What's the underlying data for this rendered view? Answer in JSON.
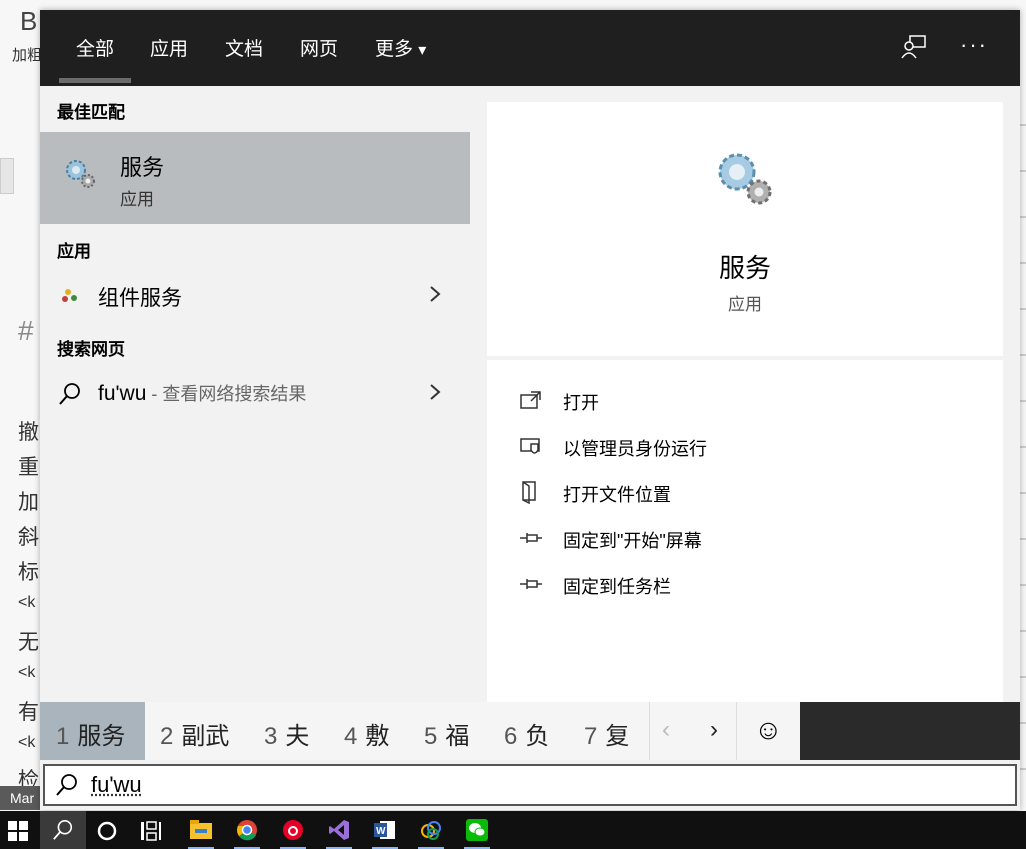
{
  "background": {
    "title_fragment": "B",
    "sub_fragment": "加粗",
    "hash": "#",
    "mar_label": "Mar",
    "left_chars": [
      "撤",
      "重",
      "加",
      "斜",
      "标",
      "<k",
      "无",
      "<k",
      "有",
      "<k",
      "检"
    ]
  },
  "nav": {
    "tabs": [
      "全部",
      "应用",
      "文档",
      "网页",
      "更多"
    ],
    "more_arrow": "▾",
    "more_dots": "···"
  },
  "left": {
    "best_match_heading": "最佳匹配",
    "best_match": {
      "title": "服务",
      "subtitle": "应用",
      "icon": "gears-icon"
    },
    "apps_heading": "应用",
    "apps": [
      {
        "label": "组件服务",
        "icon": "component-services-icon"
      }
    ],
    "web_heading": "搜索网页",
    "web": {
      "query": "fu'wu",
      "hint": " - 查看网络搜索结果"
    }
  },
  "preview": {
    "title": "服务",
    "subtitle": "应用",
    "actions": [
      {
        "label": "打开",
        "icon": "open-icon"
      },
      {
        "label": "以管理员身份运行",
        "icon": "run-as-admin-icon"
      },
      {
        "label": "打开文件位置",
        "icon": "file-location-icon"
      },
      {
        "label": "固定到\"开始\"屏幕",
        "icon": "pin-start-icon"
      },
      {
        "label": "固定到任务栏",
        "icon": "pin-taskbar-icon"
      }
    ]
  },
  "ime": {
    "candidates": [
      {
        "num": "1",
        "text": "服务"
      },
      {
        "num": "2",
        "text": "副武"
      },
      {
        "num": "3",
        "text": "夫"
      },
      {
        "num": "4",
        "text": "敷"
      },
      {
        "num": "5",
        "text": "福"
      },
      {
        "num": "6",
        "text": "负"
      },
      {
        "num": "7",
        "text": "复"
      }
    ],
    "prev": "‹",
    "next": "›",
    "emoji": "☺"
  },
  "search": {
    "value": "fu'wu"
  },
  "taskbar": {
    "items": [
      "start-icon",
      "search-icon",
      "cortana-icon",
      "task-view-icon",
      "file-explorer-icon",
      "chrome-icon",
      "netease-music-icon",
      "visual-studio-icon",
      "word-icon",
      "app-icon",
      "wechat-icon"
    ]
  },
  "colors": {
    "nav_bg": "#1f1f1f",
    "selected_row": "#b9bcbf",
    "taskbar_bg": "#101010"
  }
}
